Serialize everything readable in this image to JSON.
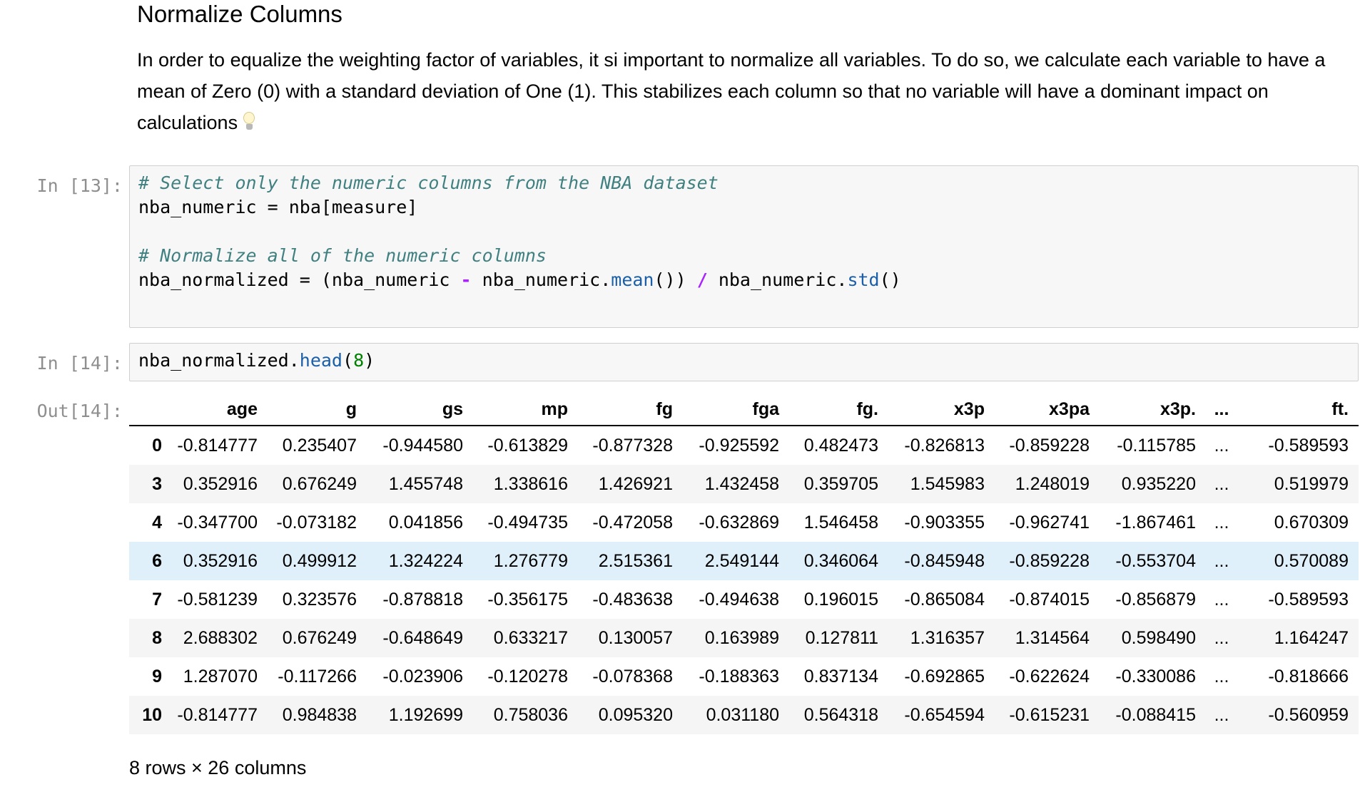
{
  "markdown": {
    "heading": "Normalize Columns",
    "paragraph": "In order to equalize the weighting factor of variables, it si important to normalize all variables. To do so, we calculate each variable to have a mean of Zero (0) with a standard deviation of One (1). This stabilizes each column so that no variable will have a dominant impact on calculations",
    "emoji_icon": "lightbulb-icon"
  },
  "cell13": {
    "prompt": "In [13]:",
    "comment1": "# Select only the numeric columns from the NBA dataset",
    "line2": "nba_numeric = nba[measure]",
    "comment2": "# Normalize all of the numeric columns",
    "line4_a": "nba_normalized = (nba_numeric ",
    "line4_op1": "-",
    "line4_b": " nba_numeric.",
    "line4_fn1": "mean",
    "line4_c": "()) ",
    "line4_op2": "/",
    "line4_d": " nba_numeric.",
    "line4_fn2": "std",
    "line4_e": "()"
  },
  "cell14": {
    "prompt": "In [14]:",
    "code_a": "nba_normalized.",
    "code_fn": "head",
    "code_b": "(",
    "code_num": "8",
    "code_c": ")",
    "out_prompt": "Out[14]:"
  },
  "table": {
    "columns": [
      "",
      "age",
      "g",
      "gs",
      "mp",
      "fg",
      "fga",
      "fg.",
      "x3p",
      "x3pa",
      "x3p.",
      "...",
      "ft."
    ],
    "rows": [
      [
        "0",
        "-0.814777",
        "0.235407",
        "-0.944580",
        "-0.613829",
        "-0.877328",
        "-0.925592",
        "0.482473",
        "-0.826813",
        "-0.859228",
        "-0.115785",
        "...",
        "-0.589593"
      ],
      [
        "3",
        "0.352916",
        "0.676249",
        "1.455748",
        "1.338616",
        "1.426921",
        "1.432458",
        "0.359705",
        "1.545983",
        "1.248019",
        "0.935220",
        "...",
        "0.519979"
      ],
      [
        "4",
        "-0.347700",
        "-0.073182",
        "0.041856",
        "-0.494735",
        "-0.472058",
        "-0.632869",
        "1.546458",
        "-0.903355",
        "-0.962741",
        "-1.867461",
        "...",
        "0.670309"
      ],
      [
        "6",
        "0.352916",
        "0.499912",
        "1.324224",
        "1.276779",
        "2.515361",
        "2.549144",
        "0.346064",
        "-0.845948",
        "-0.859228",
        "-0.553704",
        "...",
        "0.570089"
      ],
      [
        "7",
        "-0.581239",
        "0.323576",
        "-0.878818",
        "-0.356175",
        "-0.483638",
        "-0.494638",
        "0.196015",
        "-0.865084",
        "-0.874015",
        "-0.856879",
        "...",
        "-0.589593"
      ],
      [
        "8",
        "2.688302",
        "0.676249",
        "-0.648649",
        "0.633217",
        "0.130057",
        "0.163989",
        "0.127811",
        "1.316357",
        "1.314564",
        "0.598490",
        "...",
        "1.164247"
      ],
      [
        "9",
        "1.287070",
        "-0.117266",
        "-0.023906",
        "-0.120278",
        "-0.078368",
        "-0.188363",
        "0.837134",
        "-0.692865",
        "-0.622624",
        "-0.330086",
        "...",
        "-0.818666"
      ],
      [
        "10",
        "-0.814777",
        "0.984838",
        "1.192699",
        "0.758036",
        "0.095320",
        "0.031180",
        "0.564318",
        "-0.654594",
        "-0.615231",
        "-0.088415",
        "...",
        "-0.560959"
      ]
    ],
    "highlighted_row_index": 3,
    "summary": "8 rows × 26 columns"
  }
}
